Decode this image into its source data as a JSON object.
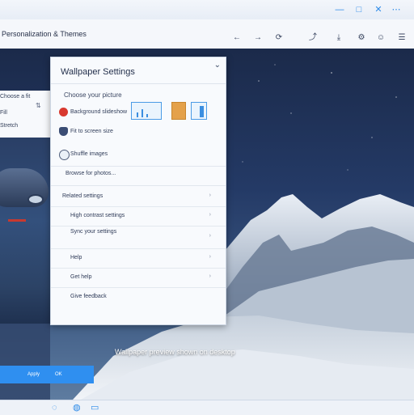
{
  "titlebar": {
    "minimize_glyph": "—",
    "maximize_glyph": "□",
    "close_glyph": "✕"
  },
  "toolbar": {
    "app_title": "Personalization & Themes",
    "back_glyph": "←",
    "forward_glyph": "→",
    "right_icons": [
      "◉",
      "▣",
      "⌂"
    ]
  },
  "panel": {
    "title": "Wallpaper Settings",
    "section_label": "Choose your picture",
    "rows": [
      {
        "icon": "red-circle",
        "text": "Background slideshow"
      },
      {
        "icon": "shield",
        "text": "Fit to screen size"
      },
      {
        "icon": "globe",
        "text": "Shuffle images"
      }
    ],
    "browse_label": "Browse for photos...",
    "list_items": [
      {
        "text": "Related settings"
      },
      {
        "text": "High contrast settings"
      },
      {
        "text": "Sync your settings"
      },
      {
        "text": "Help"
      },
      {
        "text": "Get help"
      },
      {
        "text": "Give feedback"
      }
    ],
    "accent_color": "#2f8ff0"
  },
  "left_card": {
    "lines": [
      "Choose a fit",
      "Fill",
      "Stretch"
    ]
  },
  "caption": "Wallpaper preview shown on desktop",
  "blue_button": {
    "label_left": "Apply",
    "label_right": "OK"
  },
  "taskbar": {
    "icons": [
      "start-icon",
      "browser-icon",
      "files-icon"
    ]
  },
  "colors": {
    "accent": "#2f8ff0",
    "panel_bg": "#f8fafd",
    "sky_top": "#1b2a4a"
  }
}
